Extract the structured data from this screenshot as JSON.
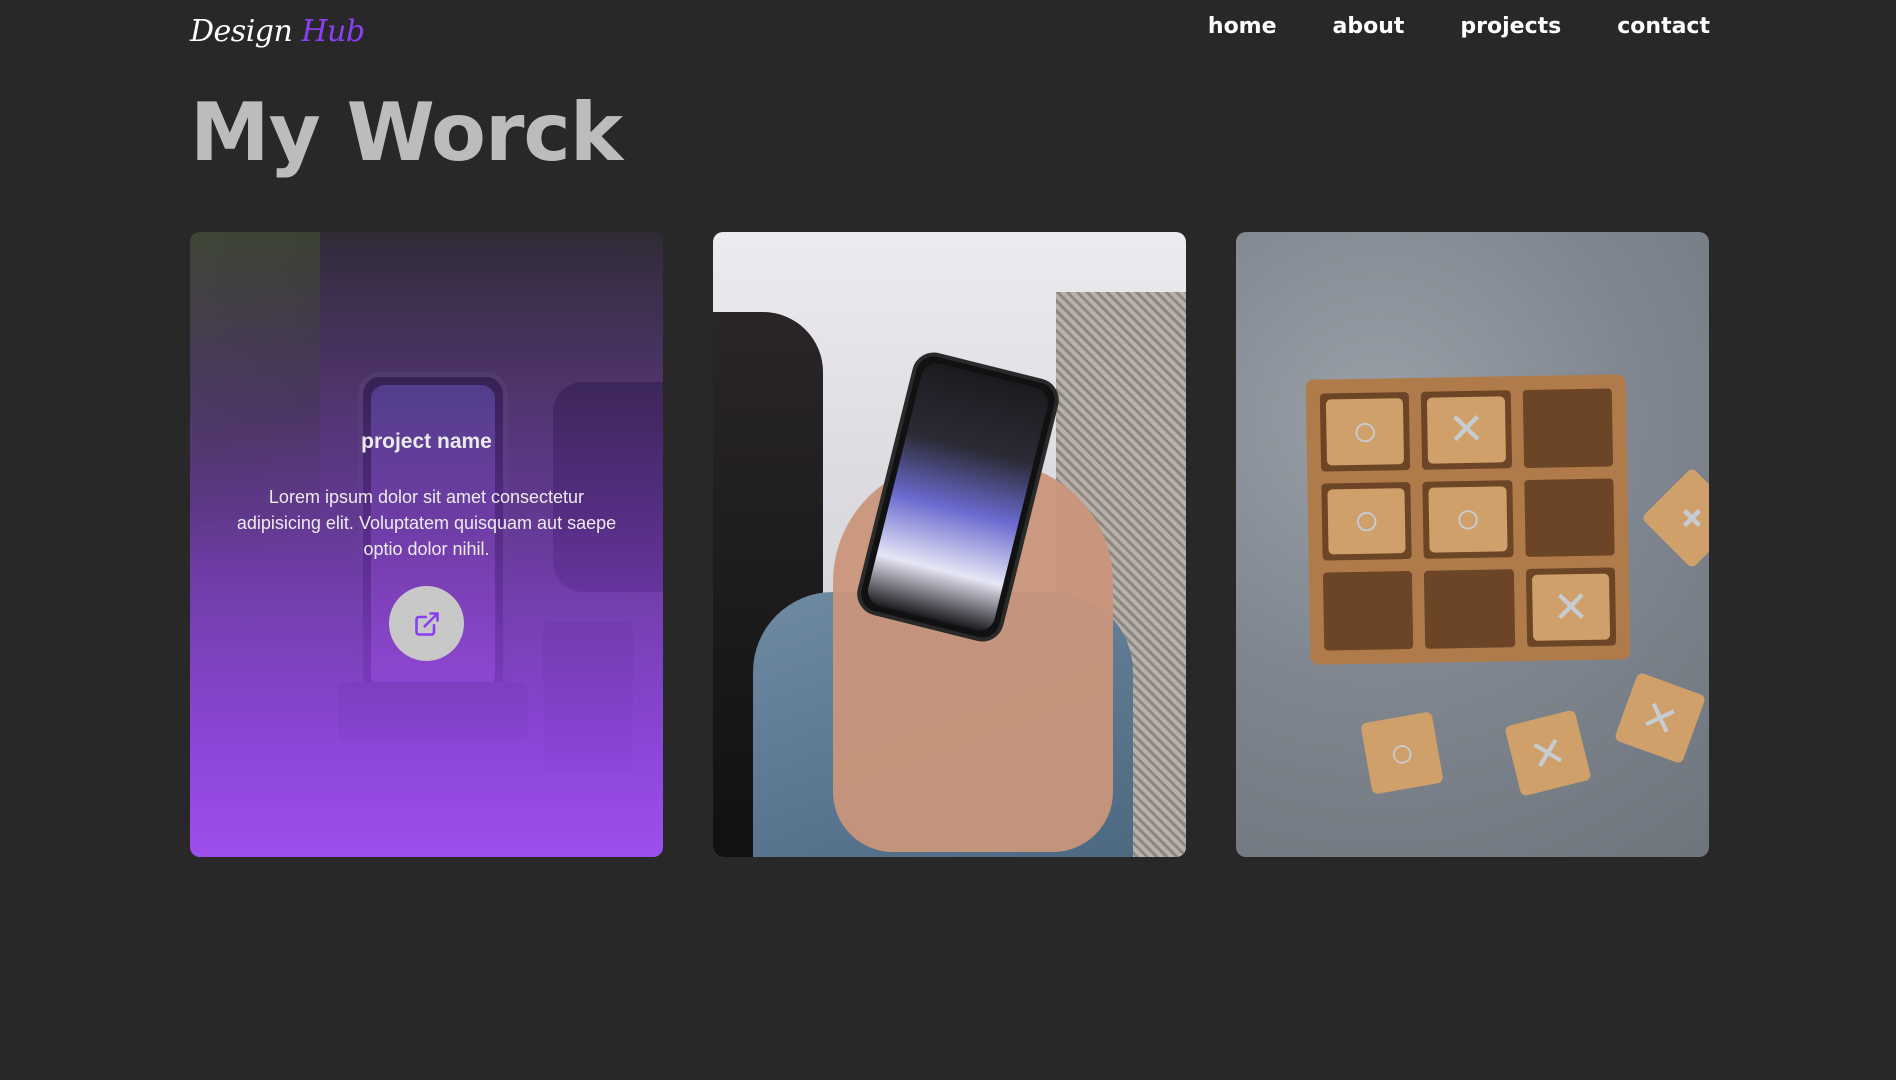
{
  "logo": {
    "main": "Design",
    "accent": "Hub"
  },
  "nav": {
    "home": "home",
    "about": "about",
    "projects": "projects",
    "contact": "contact"
  },
  "page_title": "My Worck",
  "cards": [
    {
      "name": "project name",
      "description": "Lorem ipsum dolor sit amet consectetur adipisicing elit. Voluptatem quisquam aut saepe optio dolor nihil."
    }
  ],
  "colors": {
    "background": "#282828",
    "accent": "#8a3ff0",
    "title": "#bcbcbc",
    "overlay": "#9d4fec"
  }
}
